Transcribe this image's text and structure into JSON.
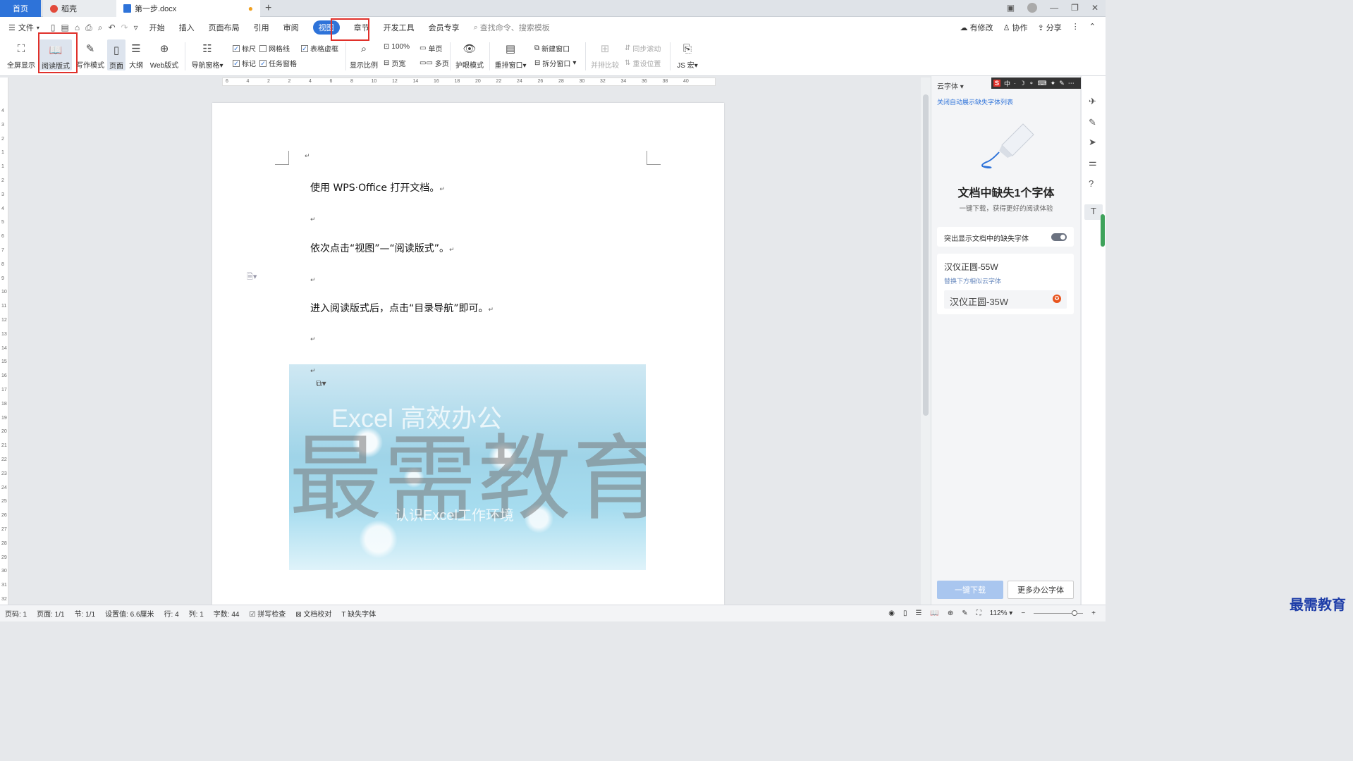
{
  "tabs": {
    "home": "首页",
    "daoke": "稻壳",
    "doc": "第一步.docx",
    "add": "+"
  },
  "window": {
    "minimize": "—",
    "restore": "❐",
    "close": "✕"
  },
  "menu": {
    "file": "文件",
    "items": [
      "开始",
      "插入",
      "页面布局",
      "引用",
      "审阅",
      "视图",
      "章节",
      "开发工具",
      "会员专享"
    ],
    "active_index": 5,
    "search": "查找命令、搜索模板",
    "right": [
      "有修改",
      "协作",
      "分享"
    ]
  },
  "ribbon": {
    "fullscreen": "全屏显示",
    "read_mode": "阅读版式",
    "write_mode": "写作模式",
    "page": "页面",
    "outline": "大纲",
    "web": "Web版式",
    "nav_pane": "导航窗格",
    "checks": [
      {
        "label": "标尺",
        "checked": true
      },
      {
        "label": "网格线",
        "checked": false
      },
      {
        "label": "表格虚框",
        "checked": true
      },
      {
        "label": "标记",
        "checked": true
      },
      {
        "label": "任务窗格",
        "checked": true
      }
    ],
    "zoom_ratio": "显示比例",
    "zoom100": "100%",
    "page_width": "页宽",
    "single": "单页",
    "multi": "多页",
    "eye_mode": "护眼模式",
    "rearrange": "重排窗口",
    "new_window": "新建窗口",
    "split_window": "拆分窗口",
    "side_by_side": "并排比较",
    "sync_scroll": "同步滚动",
    "reset_pos": "重设位置",
    "js_macro": "JS 宏"
  },
  "ruler": {
    "h": [
      "6",
      "4",
      "2",
      "2",
      "4",
      "6",
      "8",
      "10",
      "12",
      "14",
      "16",
      "18",
      "20",
      "22",
      "24",
      "26",
      "28",
      "30",
      "32",
      "34",
      "36",
      "38",
      "40"
    ],
    "v": [
      "4",
      "3",
      "2",
      "1",
      "1",
      "2",
      "3",
      "4",
      "5",
      "6",
      "7",
      "8",
      "9",
      "10",
      "11",
      "12",
      "13",
      "14",
      "15",
      "16",
      "17",
      "18",
      "19",
      "20",
      "21",
      "22",
      "23",
      "24",
      "25",
      "26",
      "27",
      "28",
      "29",
      "30",
      "31",
      "32"
    ]
  },
  "doc": {
    "p1": "使用 WPS·Office 打开文档。",
    "p2": "依次点击“视图”—“阅读版式”。",
    "p3": "进入阅读版式后，点击“目录导航”即可。",
    "ret": "↵"
  },
  "image": {
    "wm_big": "最需教育",
    "line1": "Excel 高效办公",
    "line2": "认识Excel工作环境"
  },
  "panel": {
    "title": "云字体",
    "close_link": "关闭自动展示缺失字体列表",
    "heading": "文档中缺失1个字体",
    "sub": "一键下载，获得更好的阅读体验",
    "highlight": "突出显示文档中的缺失字体",
    "font_missing": "汉仪正圆-55W",
    "replace_hint": "替换下方相似云字体",
    "font_replace": "汉仪正圆-35W",
    "download": "一键下载",
    "more": "更多办公字体"
  },
  "ime": {
    "s": "S",
    "items": [
      "中",
      "·",
      "☽",
      "⚬",
      "⌨",
      "✦",
      "✎",
      "⋯"
    ]
  },
  "status": {
    "page": "页码: 1",
    "pages": "页面: 1/1",
    "section": "节: 1/1",
    "setting": "设置值: 6.6厘米",
    "row": "行: 4",
    "col": "列: 1",
    "words": "字数: 44",
    "spell": "拼写检查",
    "proof": "文档校对",
    "missing_font": "缺失字体",
    "zoom": "112%"
  },
  "brand": "最需教育"
}
